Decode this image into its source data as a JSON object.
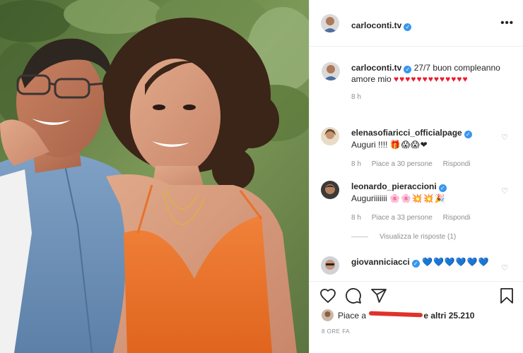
{
  "post": {
    "author": "carloconti.tv",
    "photo_alt": ""
  },
  "header": {
    "username": "carloconti.tv",
    "more_label": "•••"
  },
  "caption": {
    "username": "carloconti.tv",
    "text": "27/7 buon compleanno amore mio",
    "emojis": "♥♥♥♥♥♥♥♥♥♥♥♥♥",
    "time": "8 h"
  },
  "comments": [
    {
      "username": "elenasofiaricci_officialpage",
      "text": "Auguri !!!!",
      "emojis": "🎁😱😱❤",
      "time": "8 h",
      "likes": "Piace a 30 persone",
      "reply": "Rispondi"
    },
    {
      "username": "leonardo_pieraccioni",
      "text": "Auguriiiiiii",
      "emojis": "🌸🌸💥💥🎉",
      "time": "8 h",
      "likes": "Piace a 33 persone",
      "reply": "Rispondi"
    },
    {
      "username": "giovanniciacci",
      "text": "",
      "emojis": "💙💙💙💙💙💙",
      "time": "",
      "likes": "",
      "reply": ""
    }
  ],
  "view_replies": "Visualizza le risposte (1)",
  "likes_summary": {
    "prefix": "Piace a",
    "suffix": "e altri 25.210"
  },
  "timestamp": "8 ORE FA",
  "colors": {
    "verified": "#3897f0",
    "heart": "#ed1b2f",
    "meta": "#8e8e8e"
  }
}
